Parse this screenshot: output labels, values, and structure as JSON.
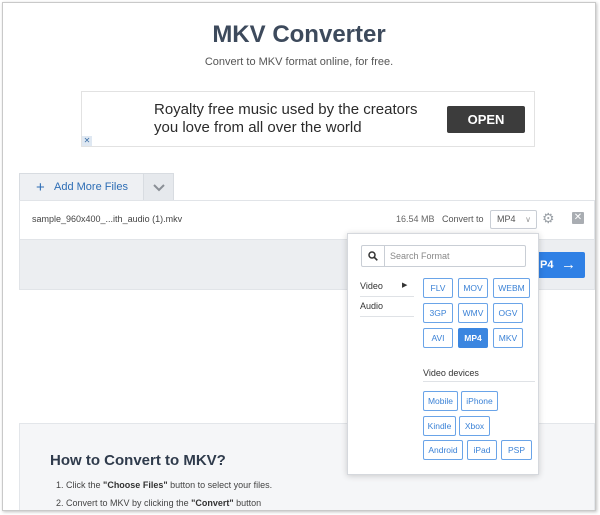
{
  "page": {
    "title": "MKV Converter",
    "subtitle": "Convert to MKV format online, for free."
  },
  "ad": {
    "text": "Royalty free music used by the creators you love from all over the world",
    "button": "OPEN",
    "close": "✕"
  },
  "uploader": {
    "add_files": "Add More Files",
    "add_icon": "plus-icon",
    "dropdown_icon": "chevron-down-icon"
  },
  "file": {
    "name": "sample_960x400_...ith_audio (1).mkv",
    "size": "16.54 MB",
    "convert_to_label": "Convert to",
    "selected_format": "MP4"
  },
  "convert": {
    "label": "P4"
  },
  "format_menu": {
    "search_placeholder": "Search Format",
    "categories": [
      "Video",
      "Audio"
    ],
    "video_formats": [
      "FLV",
      "MOV",
      "WEBM",
      "3GP",
      "WMV",
      "OGV",
      "AVI",
      "MP4",
      "MKV"
    ],
    "selected": "MP4",
    "devices_title": "Video devices",
    "devices": [
      "Mobile",
      "iPhone",
      "Kindle",
      "Xbox",
      "Android",
      "iPad",
      "PSP"
    ]
  },
  "howto": {
    "title": "How to Convert to MKV?",
    "steps": [
      {
        "num": "1.",
        "pre": "Click the ",
        "bold": "\"Choose Files\"",
        "post": " button to select your files."
      },
      {
        "num": "2.",
        "pre": "Convert to MKV by clicking the ",
        "bold": "\"Convert\"",
        "post": " button"
      }
    ]
  },
  "colors": {
    "accent": "#2f80e5",
    "chip_border": "#6aa4e8",
    "title": "#3d4a5c"
  }
}
